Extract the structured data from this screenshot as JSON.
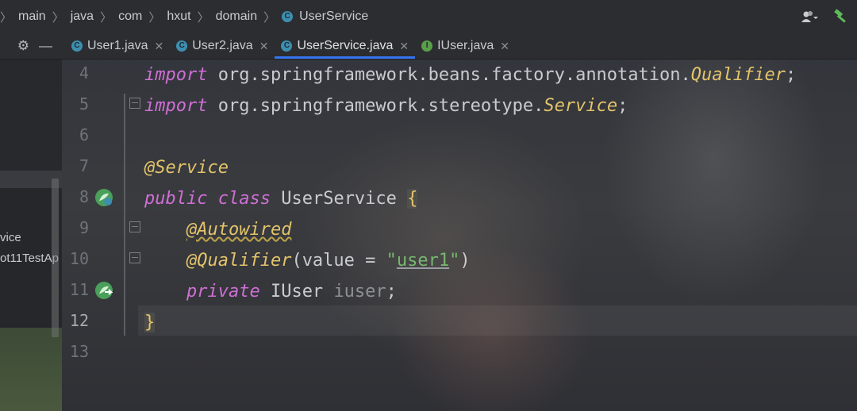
{
  "breadcrumb": {
    "items": [
      "main",
      "java",
      "com",
      "hxut",
      "domain"
    ],
    "current_class": "UserService"
  },
  "tabs": [
    {
      "label": "User1.java",
      "kind": "class",
      "active": false
    },
    {
      "label": "User2.java",
      "kind": "class",
      "active": false
    },
    {
      "label": "UserService.java",
      "kind": "class",
      "active": true
    },
    {
      "label": "IUser.java",
      "kind": "interface",
      "active": false
    }
  ],
  "project_panel": {
    "items": [
      "vice",
      "ot11TestAp"
    ]
  },
  "line_numbers": [
    "4",
    "5",
    "6",
    "7",
    "8",
    "9",
    "10",
    "11",
    "12",
    "13"
  ],
  "code": {
    "l4": {
      "kw": "import",
      "pkg": "org.springframework.beans.factory.annotation.",
      "cls": "Qualifier",
      "end": ";"
    },
    "l5": {
      "kw": "import",
      "pkg": "org.springframework.stereotype.",
      "cls": "Service",
      "end": ";"
    },
    "l7": {
      "anno": "@Service"
    },
    "l8": {
      "kw1": "public",
      "kw2": "class",
      "name": "UserService",
      "brace": "{"
    },
    "l9": {
      "anno": "@Autowired"
    },
    "l10": {
      "anno": "@Qualifier",
      "open": "(",
      "param": "value",
      "eq": " = ",
      "q1": "\"",
      "val": "user1",
      "q2": "\"",
      "close": ")"
    },
    "l11": {
      "kw": "private",
      "type": "IUser",
      "field": "iuser",
      "end": ";"
    },
    "l12": {
      "brace": "}"
    }
  },
  "icons": {
    "class": "class-icon",
    "interface": "interface-icon",
    "gear": "gear-icon",
    "minimize": "minimize-icon",
    "user": "user-icon",
    "hammer": "hammer-icon"
  },
  "colors": {
    "accent": "#3574f0",
    "keyword": "#cf6fd6",
    "annotation": "#e3c46a",
    "string": "#77b76f"
  }
}
